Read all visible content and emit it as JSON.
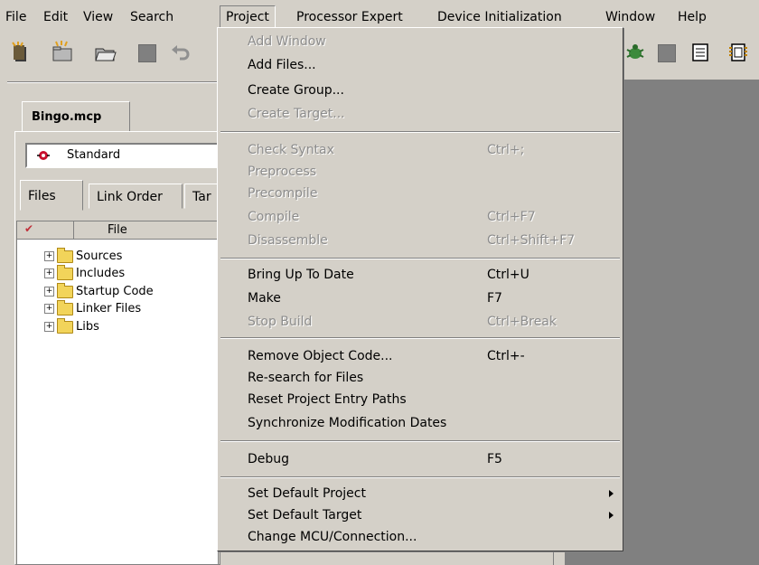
{
  "menubar": {
    "items": [
      "File",
      "Edit",
      "View",
      "Search",
      "Project",
      "Processor Expert",
      "Device Initialization",
      "Window",
      "Help"
    ]
  },
  "project_tab": "Bingo.mcp",
  "target": {
    "selected": "Standard"
  },
  "subtabs": [
    "Files",
    "Link Order",
    "Tar"
  ],
  "file_list": {
    "header": "File",
    "items": [
      "Sources",
      "Includes",
      "Startup Code",
      "Linker Files",
      "Libs"
    ]
  },
  "menu": {
    "items": [
      {
        "label": "Add Window",
        "shortcut": "",
        "enabled": false
      },
      {
        "label": "Add Files...",
        "shortcut": "",
        "enabled": true
      },
      {
        "label": "Create Group...",
        "shortcut": "",
        "enabled": true
      },
      {
        "label": "Create Target...",
        "shortcut": "",
        "enabled": false
      },
      {
        "label": "Check Syntax",
        "shortcut": "Ctrl+;",
        "enabled": false
      },
      {
        "label": "Preprocess",
        "shortcut": "",
        "enabled": false
      },
      {
        "label": "Precompile",
        "shortcut": "",
        "enabled": false
      },
      {
        "label": "Compile",
        "shortcut": "Ctrl+F7",
        "enabled": false
      },
      {
        "label": "Disassemble",
        "shortcut": "Ctrl+Shift+F7",
        "enabled": false
      },
      {
        "label": "Bring Up To Date",
        "shortcut": "Ctrl+U",
        "enabled": true
      },
      {
        "label": "Make",
        "shortcut": "F7",
        "enabled": true
      },
      {
        "label": "Stop Build",
        "shortcut": "Ctrl+Break",
        "enabled": false
      },
      {
        "label": "Remove Object Code...",
        "shortcut": "Ctrl+-",
        "enabled": true
      },
      {
        "label": "Re-search for Files",
        "shortcut": "",
        "enabled": true
      },
      {
        "label": "Reset Project Entry Paths",
        "shortcut": "",
        "enabled": true
      },
      {
        "label": "Synchronize Modification Dates",
        "shortcut": "",
        "enabled": true
      },
      {
        "label": "Debug",
        "shortcut": "F5",
        "enabled": true
      },
      {
        "label": "Set Default Project",
        "shortcut": "",
        "enabled": true,
        "submenu": true
      },
      {
        "label": "Set Default Target",
        "shortcut": "",
        "enabled": true,
        "submenu": true
      },
      {
        "label": "Change MCU/Connection...",
        "shortcut": "",
        "enabled": true
      }
    ]
  },
  "colors": {
    "face": "#d4d0c8",
    "disabled_text": "#8c8c8c",
    "workspace": "#808080"
  }
}
